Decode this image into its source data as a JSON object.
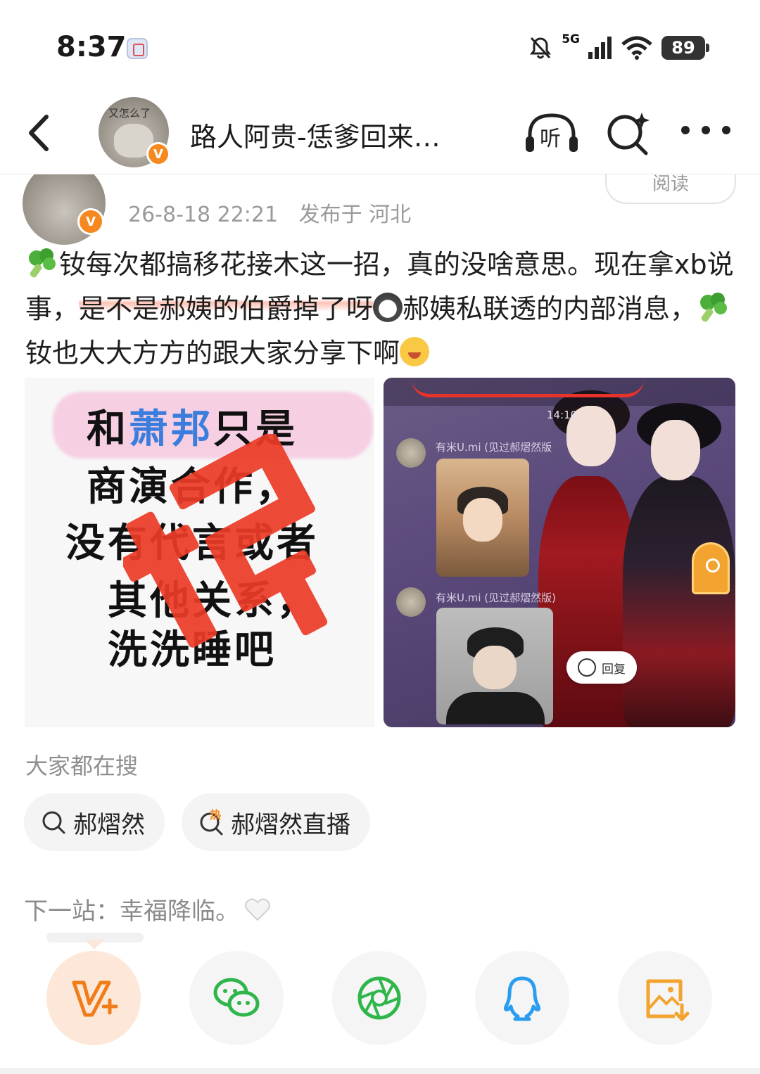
{
  "status_bar": {
    "time": "8:37",
    "network": "5G",
    "battery": "89"
  },
  "header": {
    "title": "路人阿贵-恁爹回来…",
    "avatar_caption": "又怎么了",
    "listen_label": "听",
    "verify_mark": "V"
  },
  "author": {
    "date": "26-8-18 22:21",
    "location": "发布于 河北",
    "read_label": "阅读",
    "verify_mark": "V"
  },
  "post": {
    "text_1": "钕每次都搞移花接木这一招，真的没啥意思。现在拿xb说事，",
    "highlight": "是不是郝姨的伯爵掉了呀",
    "text_2": "郝姨私联透的内部消息，",
    "text_3": "钕也大大方方的跟大家分享下啊"
  },
  "image_left": {
    "line_1_prefix": "和",
    "line_1_blue": "萧邦",
    "line_1_suffix": "只是",
    "line_2": "商演合作，",
    "line_3": "没有代言或者",
    "line_4": "其他关系，",
    "line_5": "洗洗睡吧"
  },
  "image_right": {
    "chat_time": "14:10",
    "chat_name_1": "有米U.mi (见过郝熠然版",
    "chat_name_2": "有米U.mi (见过郝熠然版)",
    "reply_label": "回复"
  },
  "trending": {
    "label": "大家都在搜",
    "items": [
      {
        "label": "郝熠然",
        "icon": "search-icon"
      },
      {
        "label": "郝熠然直播",
        "icon": "hot-search-icon",
        "badge": "热"
      }
    ]
  },
  "next_stop": {
    "text": "下一站：幸福降临。"
  },
  "share_bar": {
    "items": [
      "v-plus-icon",
      "wechat-icon",
      "moments-icon",
      "qq-icon",
      "save-image-icon"
    ]
  },
  "colors": {
    "accent_orange": "#f5891f",
    "wechat_green": "#2fb64a",
    "qq_blue": "#2b9df0",
    "save_orange": "#f3a430"
  }
}
